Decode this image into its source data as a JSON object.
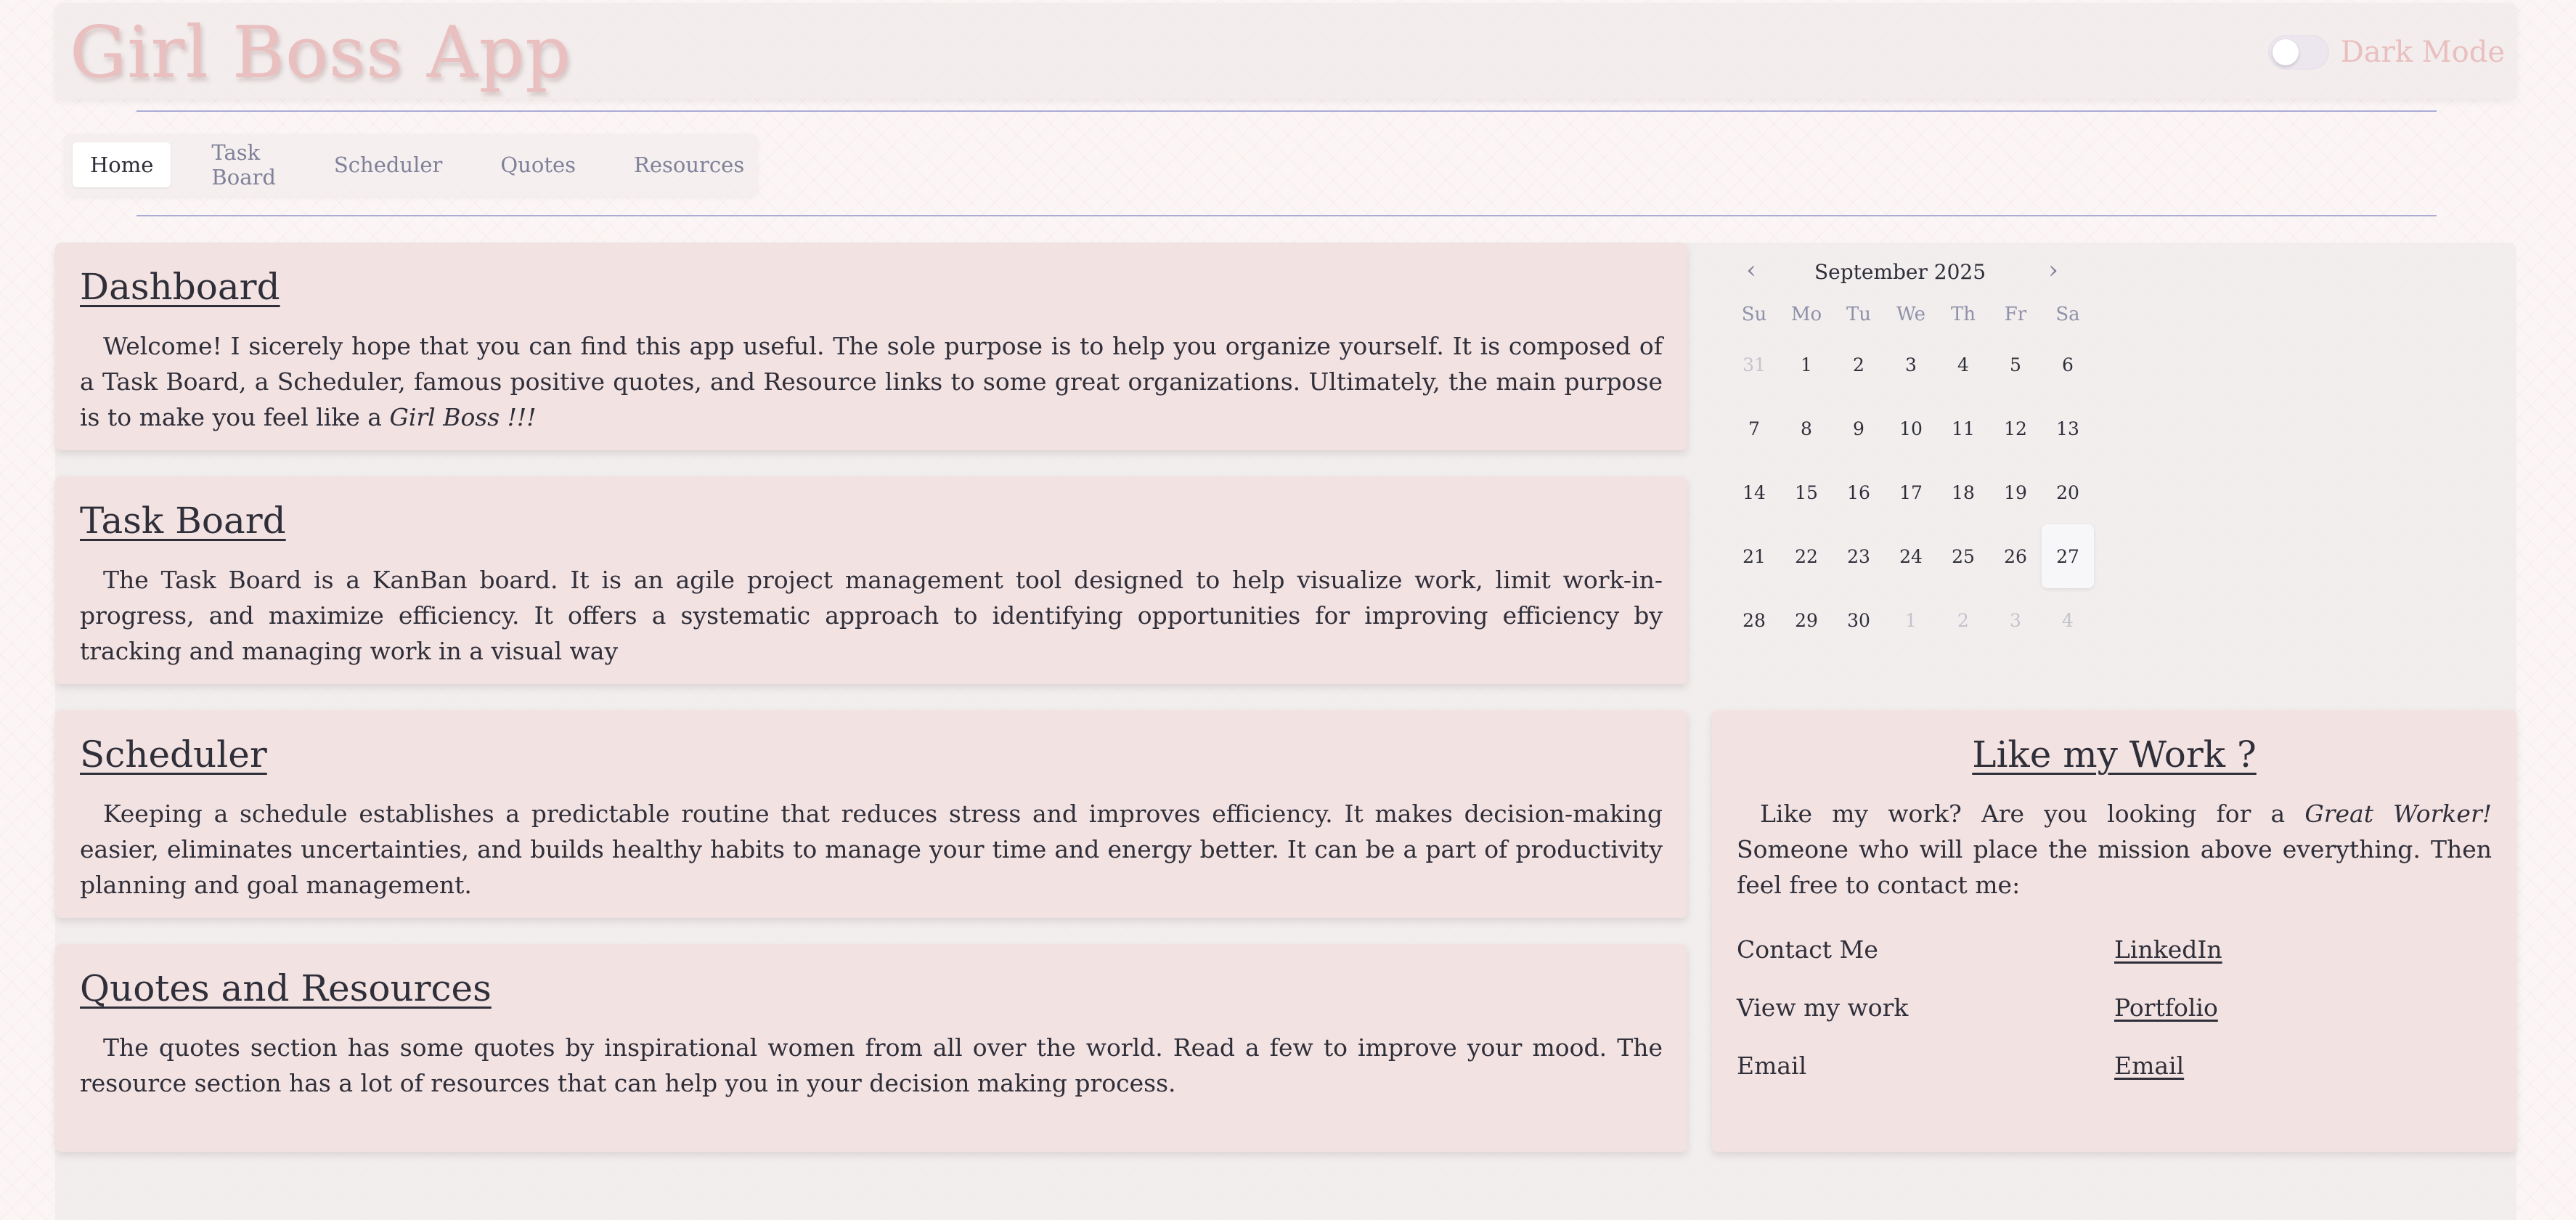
{
  "header": {
    "title": "Girl Boss App",
    "dark_mode_label": "Dark Mode",
    "dark_mode_on": false
  },
  "nav": {
    "tabs": [
      {
        "label": "Home",
        "active": true
      },
      {
        "label": "Task Board",
        "active": false
      },
      {
        "label": "Scheduler",
        "active": false
      },
      {
        "label": "Quotes",
        "active": false
      },
      {
        "label": "Resources",
        "active": false
      }
    ]
  },
  "cards": {
    "dashboard": {
      "title": "Dashboard",
      "text": "Welcome! I sicerely hope that you can find this app useful. The sole purpose is to help you organize yourself. It is composed of a Task Board, a Scheduler, famous positive quotes, and Resource links to some great organizations. Ultimately, the main purpose is to make you feel like a ",
      "emphasis": "Girl Boss !!!"
    },
    "task_board": {
      "title": "Task Board",
      "text": "The Task Board is a KanBan board. It is an agile project management tool designed to help visualize work, limit work-in-progress, and maximize efficiency. It offers a systematic approach to identifying opportunities for improving efficiency by tracking and managing work in a visual way"
    },
    "scheduler": {
      "title": "Scheduler",
      "text": "Keeping a schedule establishes a predictable routine that reduces stress and improves efficiency. It makes decision-making easier, eliminates uncertainties, and builds healthy habits to manage your time and energy better. It can be a part of productivity planning and goal management."
    },
    "quotes": {
      "title": "Quotes and Resources",
      "text": "The quotes section has some quotes by inspirational women from all over the world. Read a few to improve your mood. The resource section has a lot of resources that can help you in your decision making process."
    }
  },
  "calendar": {
    "month_label": "September 2025",
    "prev_icon": "chevron-left-icon",
    "next_icon": "chevron-right-icon",
    "weekdays": [
      "Su",
      "Mo",
      "Tu",
      "We",
      "Th",
      "Fr",
      "Sa"
    ],
    "weeks": [
      [
        {
          "d": "31",
          "m": true
        },
        {
          "d": "1"
        },
        {
          "d": "2"
        },
        {
          "d": "3"
        },
        {
          "d": "4"
        },
        {
          "d": "5"
        },
        {
          "d": "6"
        }
      ],
      [
        {
          "d": "7"
        },
        {
          "d": "8"
        },
        {
          "d": "9"
        },
        {
          "d": "10"
        },
        {
          "d": "11"
        },
        {
          "d": "12"
        },
        {
          "d": "13"
        }
      ],
      [
        {
          "d": "14"
        },
        {
          "d": "15"
        },
        {
          "d": "16"
        },
        {
          "d": "17"
        },
        {
          "d": "18"
        },
        {
          "d": "19"
        },
        {
          "d": "20"
        }
      ],
      [
        {
          "d": "21"
        },
        {
          "d": "22"
        },
        {
          "d": "23"
        },
        {
          "d": "24"
        },
        {
          "d": "25"
        },
        {
          "d": "26"
        },
        {
          "d": "27",
          "t": true
        }
      ],
      [
        {
          "d": "28"
        },
        {
          "d": "29"
        },
        {
          "d": "30"
        },
        {
          "d": "1",
          "m": true
        },
        {
          "d": "2",
          "m": true
        },
        {
          "d": "3",
          "m": true
        },
        {
          "d": "4",
          "m": true
        }
      ]
    ]
  },
  "contact": {
    "title": "Like my Work ?",
    "text_before": "Like my work? Are you looking for a ",
    "emphasis": "Great Worker!",
    "text_after": " Someone who will place the mission above everything. Then feel free to contact me:",
    "rows": [
      {
        "label": "Contact Me",
        "link": "LinkedIn"
      },
      {
        "label": "View my work",
        "link": "Portfolio"
      },
      {
        "label": "Email",
        "link": "Email"
      }
    ]
  },
  "colors": {
    "title_pink": "#e9bfbf",
    "card_bg": "#f3e2e2",
    "divider": "#a9acd6"
  }
}
